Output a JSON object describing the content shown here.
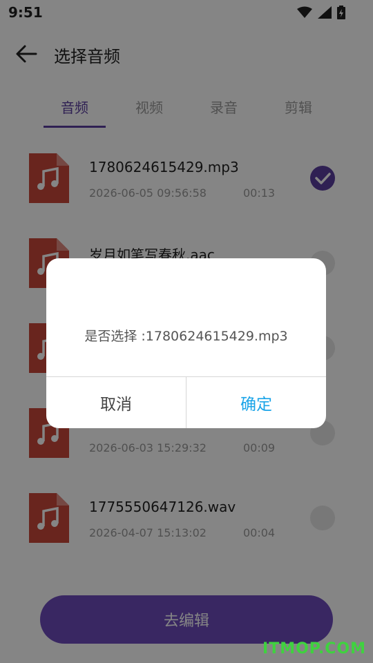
{
  "status_bar": {
    "time": "9:51"
  },
  "app_bar": {
    "title": "选择音频"
  },
  "tabs": [
    {
      "label": "音频",
      "active": true
    },
    {
      "label": "视频",
      "active": false
    },
    {
      "label": "录音",
      "active": false
    },
    {
      "label": "剪辑",
      "active": false
    }
  ],
  "files": [
    {
      "name": "1780624615429.mp3",
      "date": "2026-06-05 09:56:58",
      "duration": "00:13",
      "selected": true
    },
    {
      "name": "岁月如笔写春秋.aac",
      "date": "",
      "duration": "",
      "selected": false
    },
    {
      "name": "",
      "date": "",
      "duration": "",
      "selected": false
    },
    {
      "name": "",
      "date": "2026-06-03 15:29:32",
      "duration": "00:09",
      "selected": false
    },
    {
      "name": "1775550647126.wav",
      "date": "2026-04-07 15:13:02",
      "duration": "00:04",
      "selected": false
    }
  ],
  "bottom": {
    "edit_label": "去编辑"
  },
  "dialog": {
    "message": "是否选择 :1780624615429.mp3",
    "cancel_label": "取消",
    "confirm_label": "确定"
  },
  "watermark": "ITMOP.COM",
  "colors": {
    "accent": "#5b3fa0",
    "file_icon": "#c9473a",
    "confirm": "#1aa4e8"
  }
}
